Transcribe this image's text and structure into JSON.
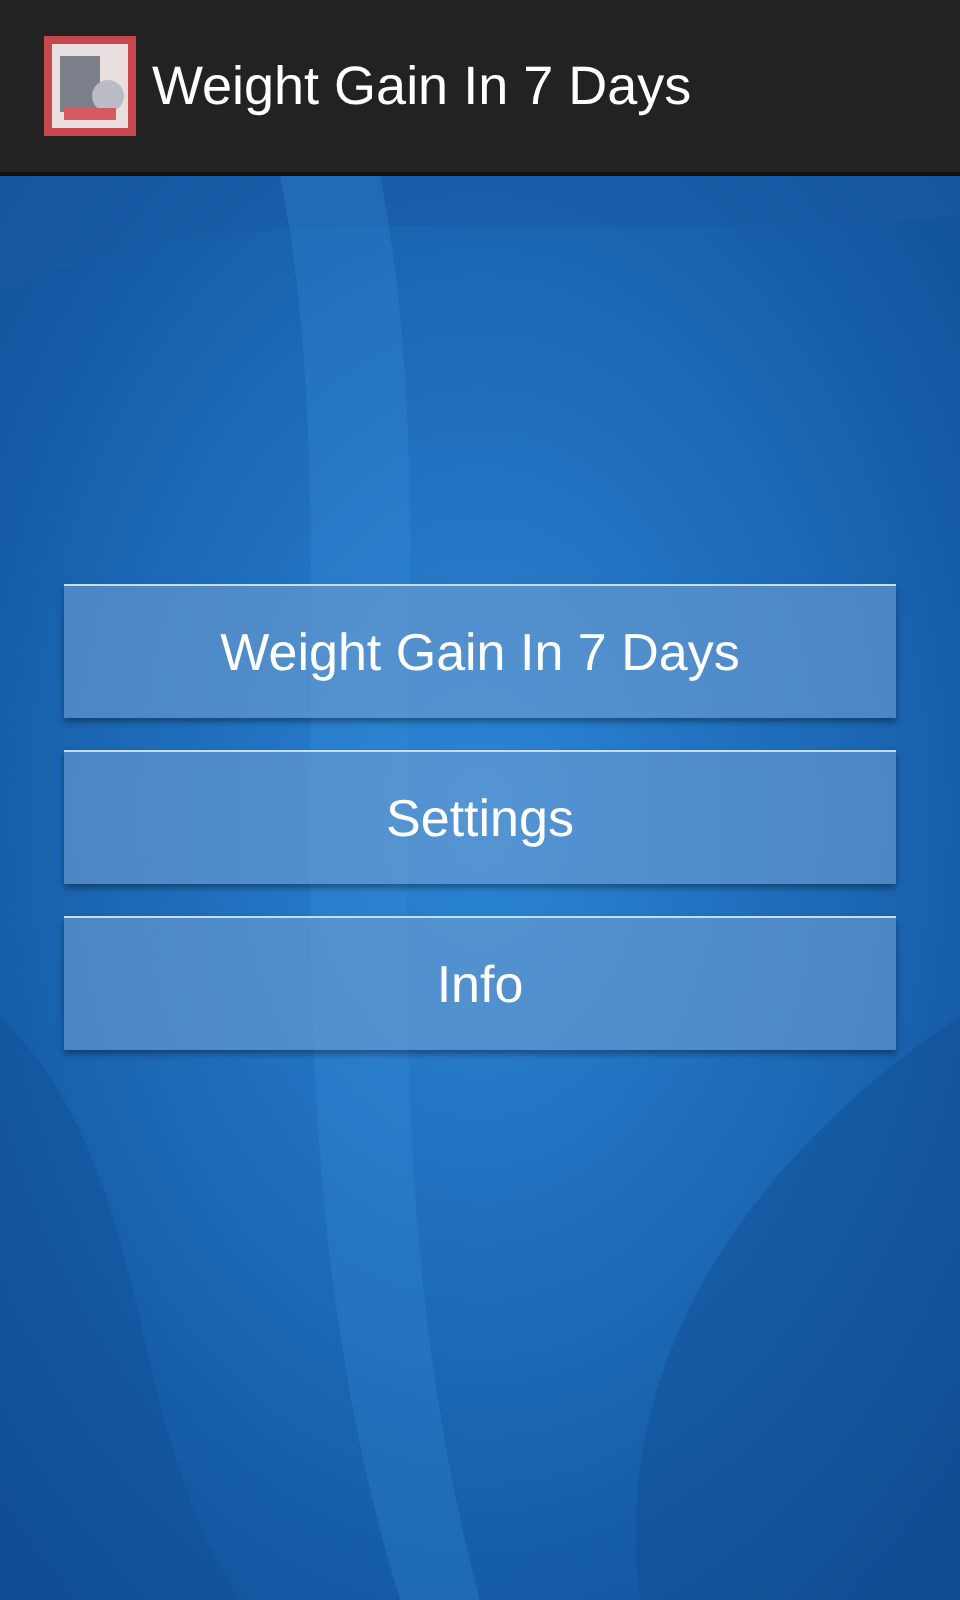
{
  "action_bar": {
    "title": "Weight Gain In 7 Days"
  },
  "menu": [
    {
      "label": "Weight Gain In 7 Days"
    },
    {
      "label": "Settings"
    },
    {
      "label": "Info"
    }
  ]
}
